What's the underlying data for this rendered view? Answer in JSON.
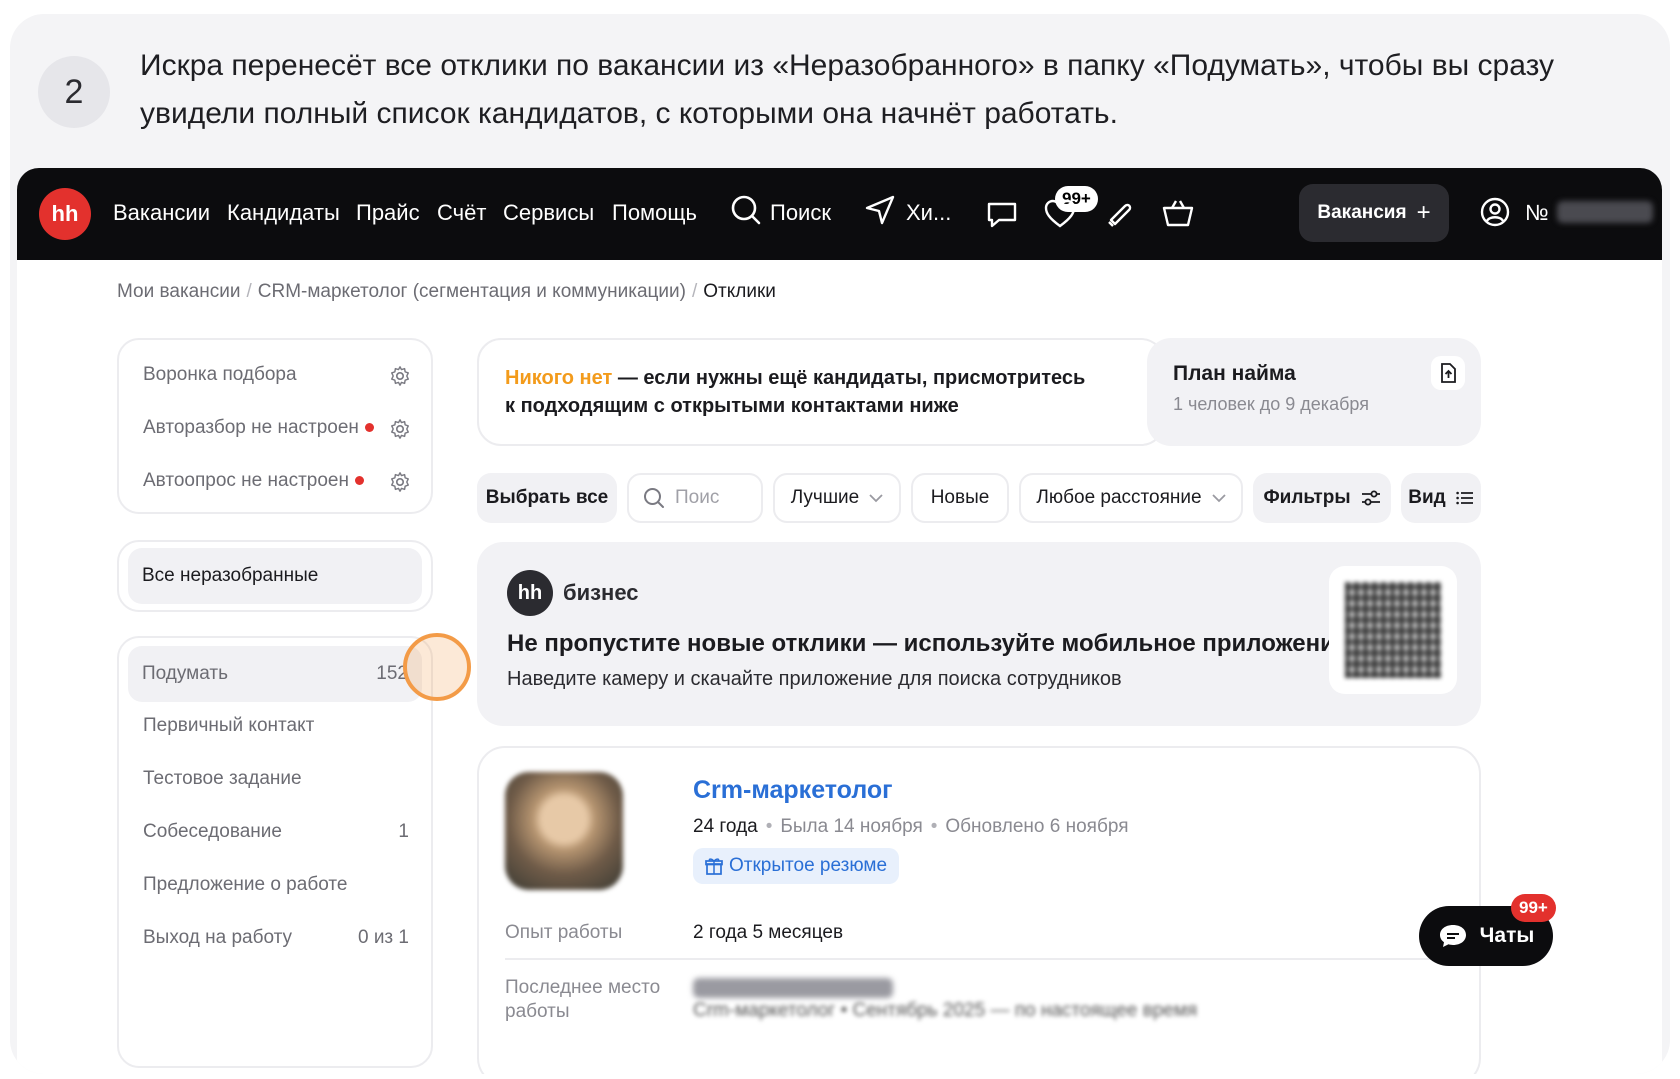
{
  "intro": {
    "step": "2",
    "text": "Искра перенесёт все отклики по вакансии из «Неразобранного» в папку «Подумать», чтобы вы сразу увидели полный список кандидатов, с которыми она начнёт работать."
  },
  "nav": {
    "logo": "hh",
    "items": [
      "Вакансии",
      "Кандидаты",
      "Прайс",
      "Счёт",
      "Сервисы",
      "Помощь"
    ],
    "search_label": "Поиск",
    "send_label": "Хи...",
    "messages_badge": "99+",
    "vacancy_button": "Вакансия",
    "account_no": "№"
  },
  "breadcrumb": {
    "items": [
      "Мои вакансии",
      "CRM-маркетолог (сегментация и коммуникации)",
      "Отклики"
    ]
  },
  "sidebar": {
    "settings": [
      {
        "label": "Воронка подбора",
        "warning": false
      },
      {
        "label": "Авторазбор не настроен",
        "warning": true
      },
      {
        "label": "Автоопрос не настроен",
        "warning": true
      }
    ],
    "unsorted": "Все неразобранные",
    "folders": [
      {
        "label": "Подумать",
        "count": "152"
      },
      {
        "label": "Первичный контакт",
        "count": ""
      },
      {
        "label": "Тестовое задание",
        "count": ""
      },
      {
        "label": "Собеседование",
        "count": "1"
      },
      {
        "label": "Предложение о работе",
        "count": ""
      },
      {
        "label": "Выход на работу",
        "count": "0 из 1"
      }
    ]
  },
  "notice": {
    "highlight": "Никого нет",
    "line1": " — если нужны ещё кандидаты, присмотритесь",
    "line2": "к подходящим с открытыми контактами ниже"
  },
  "plan": {
    "title": "План найма",
    "subtitle": "1 человек до 9 декабря"
  },
  "filters": {
    "select_all": "Выбрать все",
    "search_placeholder": "Поис",
    "sort": "Лучшие",
    "new": "Новые",
    "distance": "Любое расстояние",
    "filters": "Фильтры",
    "view": "Вид"
  },
  "promo": {
    "logo": "hh",
    "brand": "бизнес",
    "title": "Не пропустите новые отклики — используйте мобильное приложение",
    "subtitle": "Наведите камеру и скачайте приложение для поиска сотрудников"
  },
  "candidate": {
    "title": "Crm-маркетолог",
    "age": "24 года",
    "was": "Была 14 ноября",
    "updated": "Обновлено 6 ноября",
    "open_resume": "Открытое резюме",
    "exp_label": "Опыт работы",
    "exp_value": "2 года 5 месяцев",
    "last_place_label_1": "Последнее место",
    "last_place_label_2": "работы",
    "last_place_value": "Crm-маркетолог  •  Сентябрь 2025 — по настоящее время"
  },
  "chats": {
    "label": "Чаты",
    "badge": "99+"
  },
  "colors": {
    "brand_red": "#e3312d",
    "accent_orange": "#f39b1b",
    "link_blue": "#2a6fd6"
  }
}
